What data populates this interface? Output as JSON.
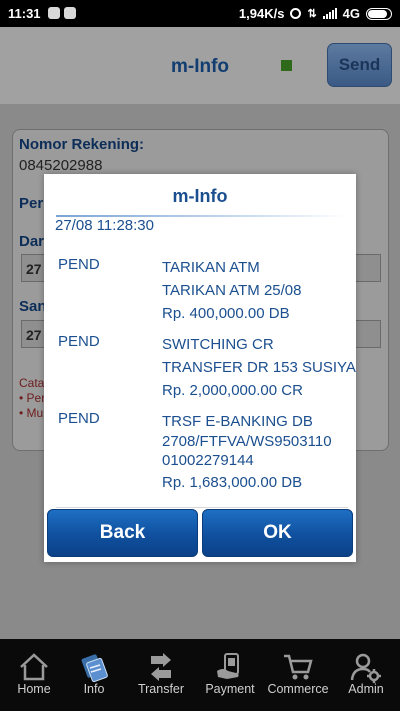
{
  "statusbar": {
    "time": "11:31",
    "network_speed": "1,94K/s",
    "network_type": "4G"
  },
  "header": {
    "title": "m-Info",
    "send_label": "Send"
  },
  "form": {
    "account_label": "Nomor Rekening:",
    "account_value": "0845202988",
    "period_label_partial": "Per",
    "from_label_partial": "Dar",
    "from_value_partial": "27",
    "to_label_partial": "San",
    "to_value_partial": "27",
    "note_partial": "Cata",
    "note_line1_partial": "• Per",
    "note_line2_partial": "• Mu"
  },
  "dialog": {
    "title": "m-Info",
    "date": "27/08 11:28:30",
    "transactions": [
      {
        "code": "PEND",
        "lines": [
          "TARIKAN ATM",
          "TARIKAN ATM 25/08",
          "Rp. 400,000.00 DB"
        ]
      },
      {
        "code": "PEND",
        "lines": [
          "SWITCHING CR",
          "TRANSFER DR 153 SUSIYA",
          "Rp. 2,000,000.00 CR"
        ]
      },
      {
        "code": "PEND",
        "lines": [
          "TRSF E-BANKING DB",
          "2708/FTFVA/WS9503110",
          "01002279144",
          "Rp. 1,683,000.00 DB"
        ]
      }
    ],
    "back_label": "Back",
    "ok_label": "OK"
  },
  "nav": [
    {
      "label": "Home",
      "icon": "home-icon"
    },
    {
      "label": "Info",
      "icon": "info-icon"
    },
    {
      "label": "Transfer",
      "icon": "transfer-icon"
    },
    {
      "label": "Payment",
      "icon": "payment-icon"
    },
    {
      "label": "Commerce",
      "icon": "cart-icon"
    },
    {
      "label": "Admin",
      "icon": "admin-icon"
    }
  ],
  "colors": {
    "primary": "#1b4f8f",
    "button": "#10509e"
  }
}
